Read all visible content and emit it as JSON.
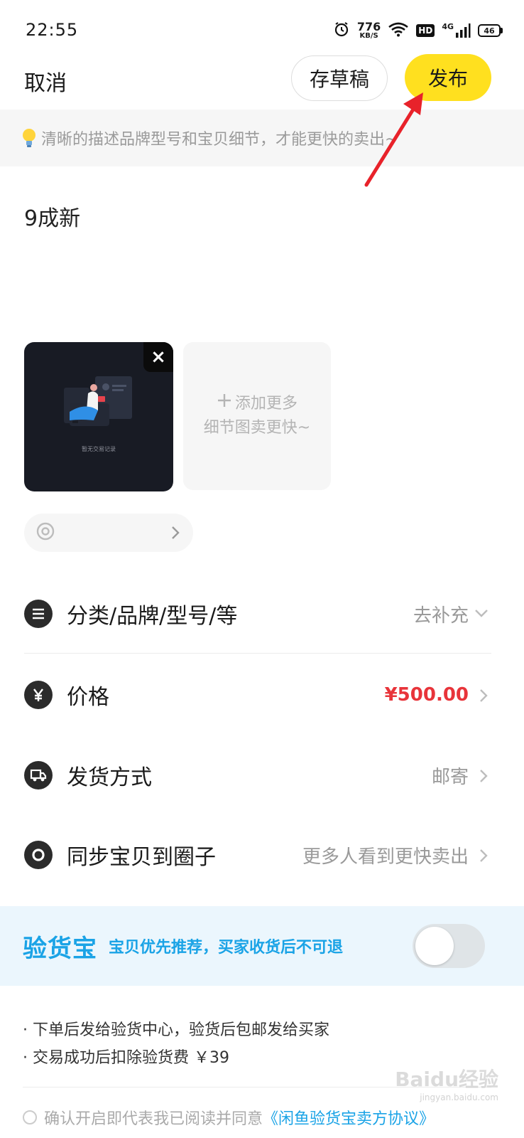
{
  "status_bar": {
    "time": "22:55",
    "net_speed": "776",
    "net_speed_unit": "KB/S",
    "hd": "HD",
    "network": "4G",
    "battery": "46"
  },
  "nav": {
    "cancel": "取消",
    "draft": "存草稿",
    "publish": "发布",
    "publish_color": "#ffe01f"
  },
  "tip": "清晰的描述品牌型号和宝贝细节，才能更快的卖出~",
  "description": "9成新",
  "photo": {
    "caption": "暂无交易记录",
    "close_label": "×"
  },
  "add_photo": {
    "line1": "添加更多",
    "line2": "细节图卖更快~"
  },
  "rows": {
    "category": {
      "label": "分类/品牌/型号/等",
      "value": "去补充"
    },
    "price": {
      "label": "价格",
      "value": "¥500.00",
      "value_color": "#e8343a"
    },
    "shipping": {
      "label": "发货方式",
      "value": "邮寄"
    },
    "sync": {
      "label": "同步宝贝到圈子",
      "value": "更多人看到更快卖出"
    }
  },
  "inspection": {
    "brand": "验货宝",
    "subtitle": "宝贝优先推荐，买家收货后不可退",
    "accent": "#1aa3e6",
    "toggle_on": false
  },
  "info_lines": [
    "· 下单后发给验货中心，验货后包邮发给买家",
    "· 交易成功后扣除验货费 ￥39"
  ],
  "agreement": {
    "text": "确认开启即代表我已阅读并同意",
    "link": "《闲鱼验货宝卖方协议》"
  },
  "watermark": {
    "main": "Baidu经验",
    "sub": "jingyan.baidu.com"
  }
}
